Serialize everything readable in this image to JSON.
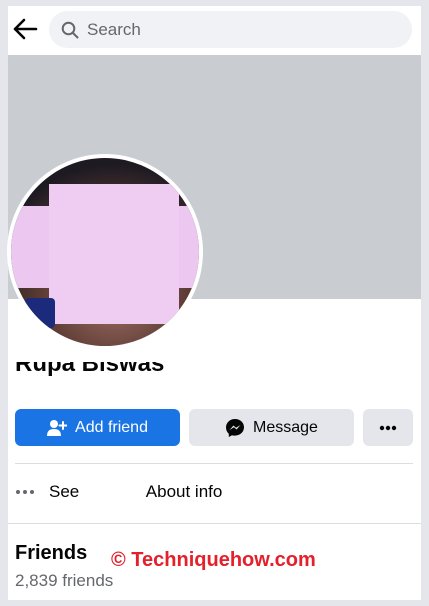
{
  "header": {
    "search_placeholder": "Search"
  },
  "profile": {
    "name": "Rupa Biswas"
  },
  "actions": {
    "add_friend_label": "Add friend",
    "message_label": "Message",
    "more_label": "•••"
  },
  "about": {
    "prefix": "See",
    "suffix": "About info"
  },
  "friends": {
    "title": "Friends",
    "count": "2,839 friends"
  },
  "watermark": {
    "text": "© Techniquehow.com"
  },
  "colors": {
    "accent": "#1b74e4",
    "cover": "#c9ccd1",
    "button_gray": "#e4e6eb",
    "watermark": "#e4202a"
  },
  "icons": {
    "back": "arrow-left-icon",
    "search": "search-icon",
    "add_friend": "person-add-icon",
    "message": "messenger-icon",
    "more": "more-dots-icon",
    "about": "more-dots-icon"
  }
}
